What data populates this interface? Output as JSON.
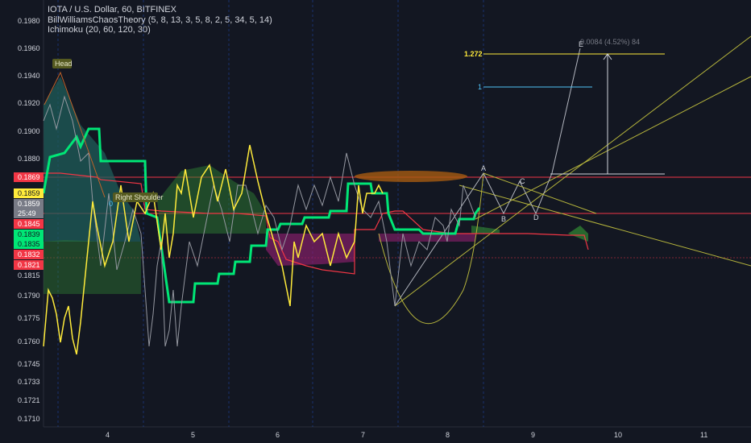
{
  "header": {
    "symbol": "IOTA / U.S. Dollar, 60, BITFINEX",
    "indicator1": "BillWilliamsChaosTheory (5, 8, 13, 3, 5, 8, 2, 5, 34, 5, 14)",
    "indicator2": "Ichimoku (20, 60, 120, 30)"
  },
  "price_axis": {
    "ticks": [
      "0.1980",
      "0.1960",
      "0.1940",
      "0.1920",
      "0.1900",
      "0.1880",
      "0.1790",
      "0.1775",
      "0.1760",
      "0.1745",
      "0.1733",
      "0.1721",
      "0.1710"
    ],
    "tags": [
      {
        "text": "0.1869",
        "bg": "#f23645",
        "fg": "#ffffff"
      },
      {
        "text": "0.1859",
        "bg": "#ffeb3b",
        "fg": "#131722"
      },
      {
        "text": "0.1859",
        "bg": "#787b86",
        "fg": "#ffffff"
      },
      {
        "text": "25:49",
        "bg": "#787b86",
        "fg": "#ffffff"
      },
      {
        "text": "0.1845",
        "bg": "#f23645",
        "fg": "#ffffff"
      },
      {
        "text": "0.1839",
        "bg": "#00e676",
        "fg": "#131722"
      },
      {
        "text": "0.1835",
        "bg": "#00e676",
        "fg": "#131722"
      },
      {
        "text": "0.1832",
        "bg": "#f23645",
        "fg": "#ffffff"
      },
      {
        "text": "0.1821",
        "bg": "#f23645",
        "fg": "#ffffff"
      },
      {
        "text": "0.1815",
        "bg": "#131722",
        "fg": "#d1d4dc"
      }
    ]
  },
  "time_axis": {
    "ticks": [
      "4",
      "5",
      "6",
      "7",
      "8",
      "9",
      "10",
      "11"
    ]
  },
  "annotations": {
    "head": "Head",
    "right_shoulder": "Right Shoulder",
    "fib_1272": "1.272",
    "fib_1": "1",
    "fib_0": "0",
    "measure": "0.0084 (4.52%) 84",
    "points": {
      "a": "A",
      "b": "B",
      "c": "C",
      "d": "D",
      "e": "E"
    }
  },
  "colors": {
    "background": "#131722",
    "conversion_line": "#00e676",
    "base_line": "#f23645",
    "lagging_line": "#ffeb3b",
    "price_line": "#b2b5be",
    "pattern_lines": "#b5b43c",
    "cloud_bull": "#2e7d32",
    "cloud_bear": "#8e1f6e"
  }
}
